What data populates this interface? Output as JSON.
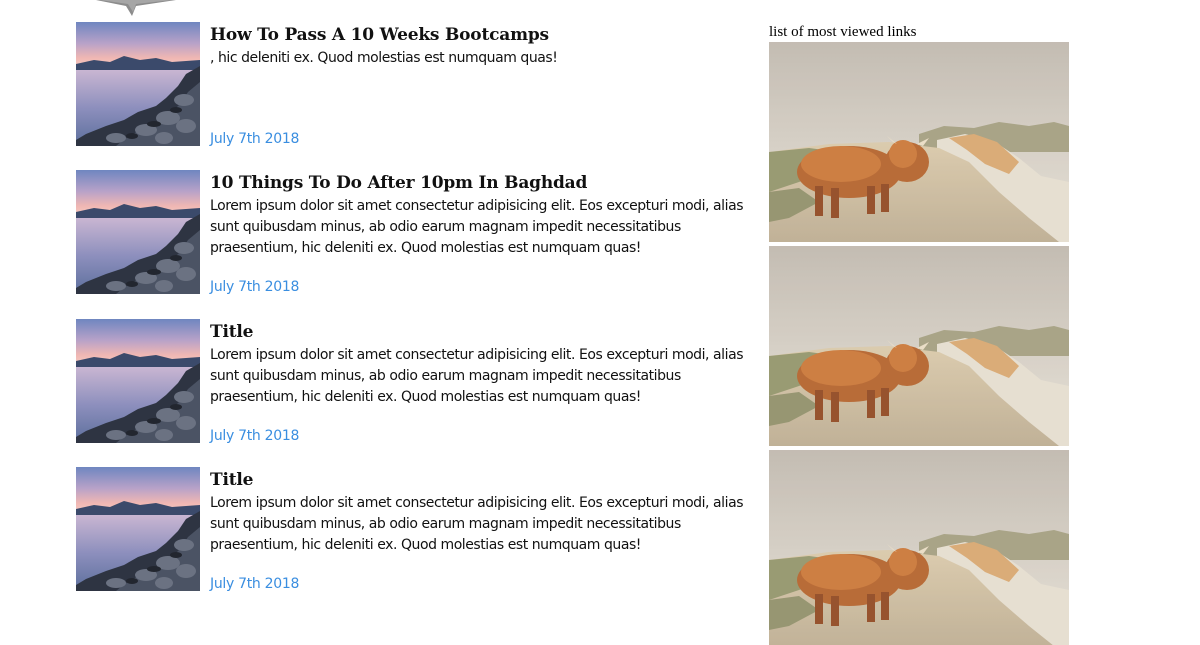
{
  "articles": [
    {
      "title": "How To Pass A 10 Weeks Bootcamps",
      "body": ", hic deleniti ex. Quod molestias est numquam quas!",
      "date": "July 7th 2018",
      "image": "lake-sunset-thumbnail"
    },
    {
      "title": "10 Things To Do After 10pm In Baghdad",
      "body": "Lorem ipsum dolor sit amet consectetur adipisicing elit. Eos excepturi modi, alias sunt quibusdam minus, ab odio earum magnam impedit necessitatibus praesentium, hic deleniti ex. Quod molestias est numquam quas!",
      "date": "July 7th 2018",
      "image": "lake-sunset-thumbnail"
    },
    {
      "title": "Title",
      "body": "Lorem ipsum dolor sit amet consectetur adipisicing elit. Eos excepturi modi, alias sunt quibusdam minus, ab odio earum magnam impedit necessitatibus praesentium, hic deleniti ex. Quod molestias est numquam quas!",
      "date": "July 7th 2018",
      "image": "lake-sunset-thumbnail"
    },
    {
      "title": "Title",
      "body": "Lorem ipsum dolor sit amet consectetur adipisicing elit. Eos excepturi modi, alias sunt quibusdam minus, ab odio earum magnam impedit necessitatibus praesentium, hic deleniti ex. Quod molestias est numquam quas!",
      "date": "July 7th 2018",
      "image": "lake-sunset-thumbnail"
    }
  ],
  "sidebar": {
    "heading": "list of most viewed links",
    "links": [
      {
        "image": "highland-cow-photo"
      },
      {
        "image": "highland-cow-photo"
      },
      {
        "image": "highland-cow-photo"
      }
    ]
  },
  "colors": {
    "date": "#3a8ee0",
    "text": "#111111"
  }
}
